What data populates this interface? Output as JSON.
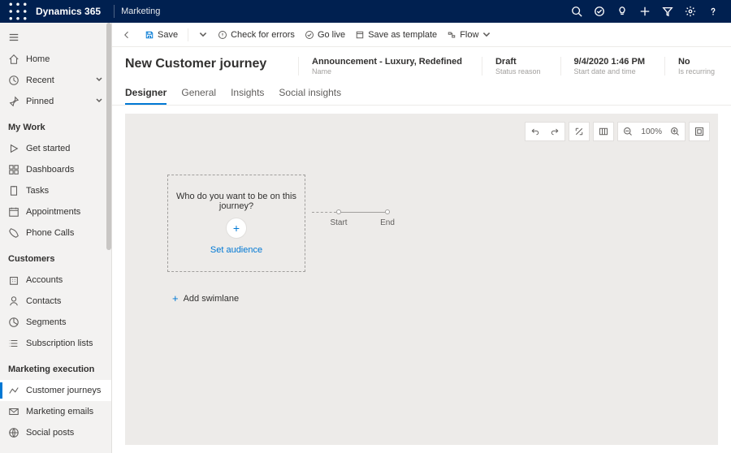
{
  "topbar": {
    "brand": "Dynamics 365",
    "area": "Marketing"
  },
  "sidebar": {
    "home": "Home",
    "recent": "Recent",
    "pinned": "Pinned",
    "sections": [
      {
        "heading": "My Work",
        "items": [
          {
            "id": "get-started",
            "label": "Get started",
            "icon": "play"
          },
          {
            "id": "dashboards",
            "label": "Dashboards",
            "icon": "dashboard"
          },
          {
            "id": "tasks",
            "label": "Tasks",
            "icon": "clipboard"
          },
          {
            "id": "appointments",
            "label": "Appointments",
            "icon": "calendar"
          },
          {
            "id": "phone-calls",
            "label": "Phone Calls",
            "icon": "phone"
          }
        ]
      },
      {
        "heading": "Customers",
        "items": [
          {
            "id": "accounts",
            "label": "Accounts",
            "icon": "building"
          },
          {
            "id": "contacts",
            "label": "Contacts",
            "icon": "person"
          },
          {
            "id": "segments",
            "label": "Segments",
            "icon": "segment"
          },
          {
            "id": "subscription-lists",
            "label": "Subscription lists",
            "icon": "list"
          }
        ]
      },
      {
        "heading": "Marketing execution",
        "items": [
          {
            "id": "customer-journeys",
            "label": "Customer journeys",
            "icon": "journey",
            "active": true
          },
          {
            "id": "marketing-emails",
            "label": "Marketing emails",
            "icon": "mail"
          },
          {
            "id": "social-posts",
            "label": "Social posts",
            "icon": "social"
          }
        ]
      }
    ]
  },
  "cmdbar": {
    "save": "Save",
    "check_errors": "Check for errors",
    "go_live": "Go live",
    "save_template": "Save as template",
    "flow": "Flow"
  },
  "header": {
    "title": "New Customer journey",
    "fields": [
      {
        "value": "Announcement - Luxury, Redefined",
        "label": "Name"
      },
      {
        "value": "Draft",
        "label": "Status reason"
      },
      {
        "value": "9/4/2020 1:46 PM",
        "label": "Start date and time"
      },
      {
        "value": "No",
        "label": "Is recurring"
      }
    ]
  },
  "tabs": [
    "Designer",
    "General",
    "Insights",
    "Social insights"
  ],
  "canvas": {
    "audience_prompt": "Who do you want to be on this journey?",
    "set_audience": "Set audience",
    "start": "Start",
    "end": "End",
    "add_swimlane": "Add swimlane",
    "zoom": "100%"
  }
}
